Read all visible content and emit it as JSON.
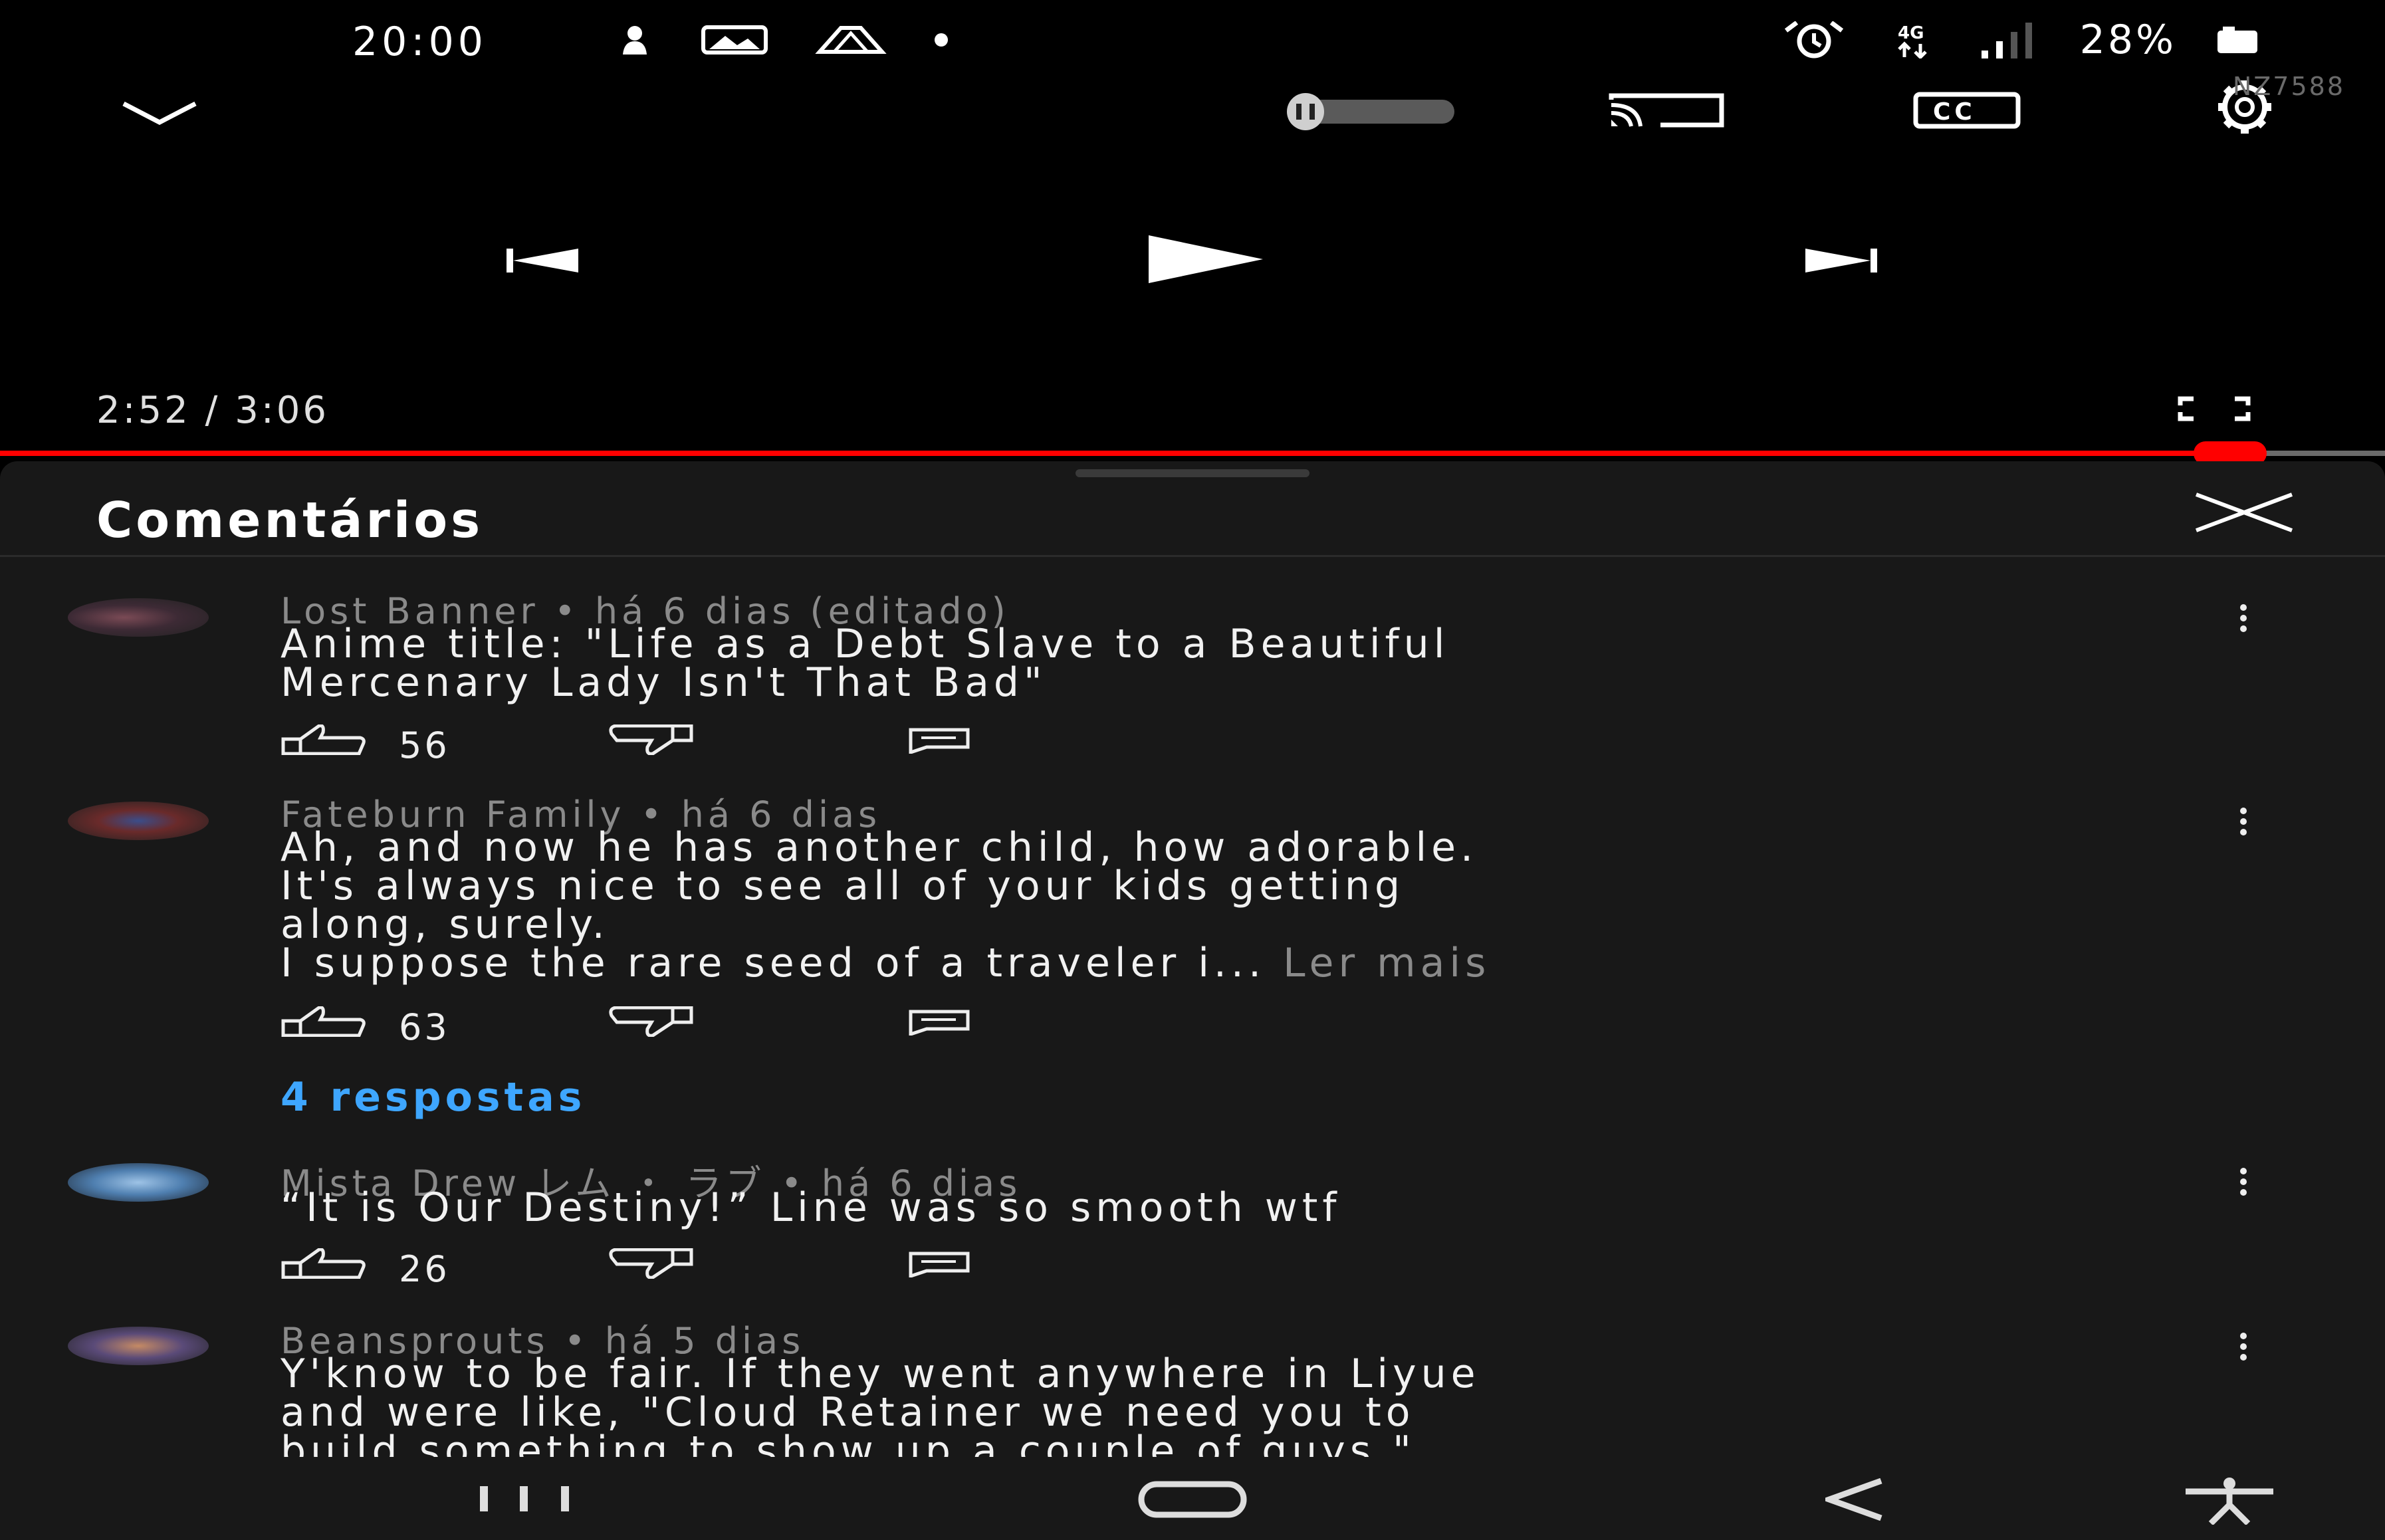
{
  "status_bar": {
    "time": "20:00",
    "battery": "28%",
    "left_icons": [
      "person-notification-icon",
      "gallery-icon",
      "drive-icon",
      "dot-icon"
    ],
    "right_icons": [
      "alarm-icon",
      "4g-icon",
      "signal-icon",
      "battery-icon"
    ]
  },
  "watermark": "NZ7588",
  "player": {
    "time_display": "2:52 / 3:06",
    "progress_fraction": 0.935,
    "autoplay": "paused"
  },
  "comments_panel": {
    "title": "Comentários",
    "comments": [
      {
        "meta": "Lost Banner • há 6 dias (editado)",
        "text": "Anime title: \"Life as a Debt Slave to a Beautiful\nMercenary Lady Isn't That Bad\"",
        "likes": "56"
      },
      {
        "meta": "Fateburn Family • há 6 dias",
        "text": "Ah, and now he has another child, how adorable.\nIt's always nice to see all of your kids getting\nalong, surely.\nI suppose the rare seed of a traveler i... ",
        "read_more": "Ler mais",
        "likes": "63",
        "replies": "4 respostas"
      },
      {
        "meta": "Mista Drew レム ・ ラブ • há 6 dias",
        "text": "“It is Our Destiny!” Line was so smooth wtf",
        "likes": "26"
      },
      {
        "meta": "Beansprouts • há 5 dias",
        "text": "Y'know to be fair.  If they went anywhere in Liyue\nand were like, \"Cloud Retainer we need you to\nbuild something to show up a couple of guys.\""
      }
    ]
  },
  "colors": {
    "progress": "#ff0000",
    "link": "#3ea6ff",
    "panel_bg": "#181818"
  }
}
